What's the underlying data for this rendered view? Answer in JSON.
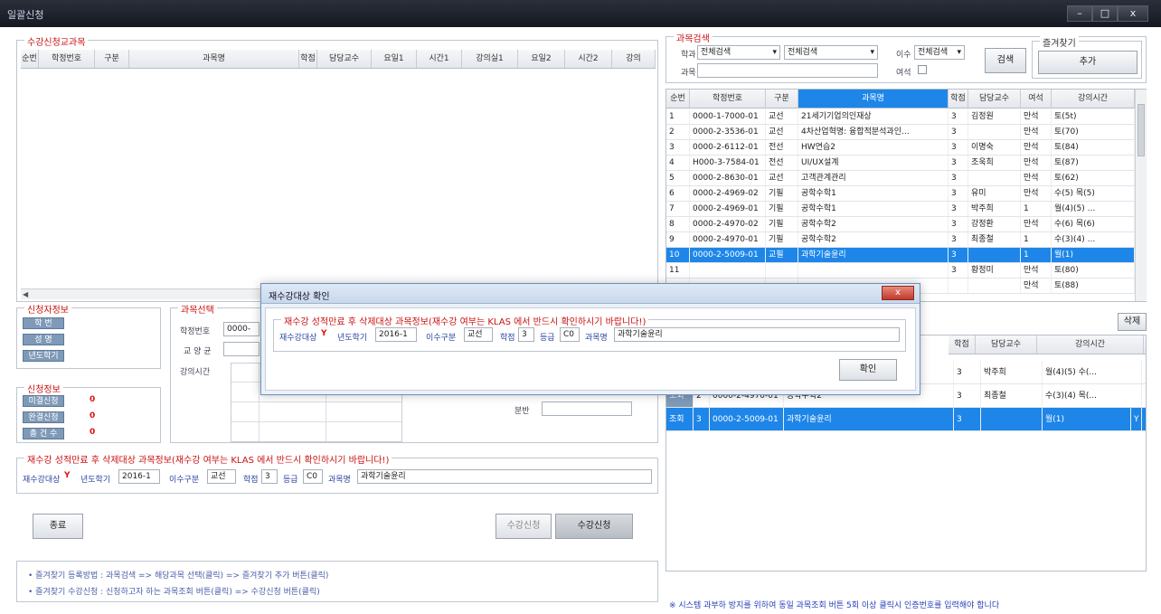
{
  "window": {
    "title": "일괄신청",
    "min": "–",
    "max": "□",
    "close": "x"
  },
  "left": {
    "group_label": "수강신청교과목",
    "columns": [
      "순번",
      "학정번호",
      "구분",
      "과목명",
      "학점",
      "담당교수",
      "요일1",
      "시간1",
      "강의실1",
      "요일2",
      "시간2",
      "강의"
    ]
  },
  "search": {
    "group_label": "과목검색",
    "campus_label": "학과",
    "campus_value": "전체검색",
    "sub_value": "전체검색",
    "isu_label": "이수",
    "isu_value": "전체검색",
    "name_label": "과목",
    "name_value": "",
    "yeo_label": "여석",
    "search_btn": "검색",
    "fav_group": "즐겨찾기",
    "fav_add": "추가",
    "columns": [
      "순번",
      "학정번호",
      "구분",
      "과목명",
      "학점",
      "담당교수",
      "여석",
      "강의시간"
    ],
    "rows": [
      [
        "1",
        "0000-1-7000-01",
        "교선",
        "21세기기업의인재상",
        "3",
        "김정원",
        "만석",
        "토(5t)"
      ],
      [
        "2",
        "0000-2-3536-01",
        "교선",
        "4차산업혁명: 융합적분석과인...",
        "3",
        "",
        "만석",
        "토(70)"
      ],
      [
        "3",
        "0000-2-6112-01",
        "전선",
        "HW연습2",
        "3",
        "이명숙",
        "만석",
        "토(84)"
      ],
      [
        "4",
        "H000-3-7584-01",
        "전선",
        "UI/UX설계",
        "3",
        "조욱희",
        "만석",
        "토(87)"
      ],
      [
        "5",
        "0000-2-8630-01",
        "교선",
        "고객관계관리",
        "3",
        "",
        "만석",
        "토(62)"
      ],
      [
        "6",
        "0000-2-4969-02",
        "기필",
        "공학수학1",
        "3",
        "유미",
        "만석",
        "수(5) 목(5)"
      ],
      [
        "7",
        "0000-2-4969-01",
        "기필",
        "공학수학1",
        "3",
        "박주희",
        "1",
        "월(4)(5) ..."
      ],
      [
        "8",
        "0000-2-4970-02",
        "기필",
        "공학수학2",
        "3",
        "강정환",
        "만석",
        "수(6) 목(6)"
      ],
      [
        "9",
        "0000-2-4970-01",
        "기필",
        "공학수학2",
        "3",
        "최종철",
        "1",
        "수(3)(4) ..."
      ],
      [
        "10",
        "0000-2-5009-01",
        "교필",
        "과학기술윤리",
        "3",
        "",
        "1",
        "월(1)"
      ],
      [
        "11",
        "",
        "",
        "",
        "3",
        "황정미",
        "만석",
        "토(80)"
      ],
      [
        "",
        "",
        "",
        "",
        "",
        "",
        "만석",
        "토(88)"
      ]
    ]
  },
  "basket": {
    "delete_btn": "삭제",
    "columns": [
      "학점",
      "담당교수",
      "강의시간"
    ],
    "rows": [
      [
        "",
        "",
        "",
        "",
        "3",
        "박주희",
        "월(4)(5) 수(..."
      ],
      [
        "조회",
        "2",
        "0000-2-4970-01",
        "공학수학2",
        "3",
        "최종철",
        "수(3)(4) 목(..."
      ],
      [
        "조회",
        "3",
        "0000-2-5009-01",
        "과학기술윤리",
        "3",
        "",
        "월(1)"
      ]
    ],
    "row3_extra": "Y"
  },
  "student": {
    "group_label": "신청자정보",
    "fields": [
      "학 번",
      "성 명",
      "년도학기"
    ]
  },
  "stats": {
    "group_label": "신청정보",
    "items": [
      {
        "label": "미결신청",
        "value": "0"
      },
      {
        "label": "완결신청",
        "value": "0"
      },
      {
        "label": "총 건 수",
        "value": "0"
      }
    ]
  },
  "course": {
    "group_label": "과목선택",
    "hakjung_label": "학정번호",
    "hakjung_value": "0000-",
    "gyoyang_label": "교 양 균",
    "time_label": "강의시간",
    "bunban_label": "분반"
  },
  "retake": {
    "group_label": "재수강 성적만료 후 삭제대상 과목정보(재수강 여부는 KLAS 에서 반드시 확인하시기 바랍니다!)",
    "target_label": "재수강대상",
    "target_value": "Y",
    "year_label": "년도학기",
    "year_value": "2016-1",
    "isu_label": "이수구분",
    "isu_value": "교선",
    "credit_label": "학점",
    "credit_value": "3",
    "grade_label": "등급",
    "grade_value": "C0",
    "course_label": "과목명",
    "course_value": "과학기술윤리"
  },
  "buttons": {
    "close": "종료",
    "confirm_apply": "수강신청",
    "apply": "수강신청"
  },
  "notes": [
    "• 즐겨찾기 등록방법 : 과목검색 => 해당과목 선택(클릭) => 즐겨찾기 추가 버튼(클릭)",
    "• 즐겨찾기 수강신청 : 신청하고자 하는 과목조회 버튼(클릭) => 수강신청 버튼(클릭)"
  ],
  "warning": "※ 시스템 과부하 방지를 위하여 동일 과목조회 버튼 5회 이상 클릭시 인증번호를 입력해야 합니다",
  "dialog": {
    "title": "재수강대상 확인",
    "ok": "확인",
    "close": "x"
  }
}
